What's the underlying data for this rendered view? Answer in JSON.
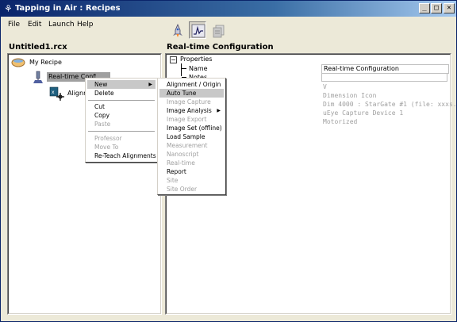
{
  "window": {
    "title": "Tapping in Air : Recipes"
  },
  "titlebar_buttons": {
    "minimize": "_",
    "maximize": "□",
    "close": "✕"
  },
  "menubar": [
    "File",
    "Edit",
    "Launch",
    "Help"
  ],
  "left": {
    "title": "Untitled1.rcx",
    "tree": {
      "root": "My Recipe",
      "child": "Real-time Configuration",
      "grandchild": "Alignment"
    }
  },
  "right": {
    "title": "Real-time Configuration",
    "properties_label": "Properties",
    "property_names": [
      "Name",
      "Notes"
    ],
    "header_field": "Real-time Configuration",
    "values": [
      "V",
      "Dimension Icon",
      "Dim 4000 : StarGate #1 (file: xxxs...",
      "uEye Capture Device 1",
      "Motorized"
    ]
  },
  "context_menu": {
    "items": [
      {
        "label": "New",
        "submenu": true,
        "highlighted": true
      },
      {
        "label": "Delete"
      },
      {
        "sep": true
      },
      {
        "label": "Cut"
      },
      {
        "label": "Copy"
      },
      {
        "label": "Paste",
        "disabled": true
      },
      {
        "sep": true
      },
      {
        "label": "Professor",
        "disabled": true
      },
      {
        "label": "Move To",
        "disabled": true
      },
      {
        "label": "Re-Teach Alignments"
      }
    ]
  },
  "submenu": {
    "items": [
      {
        "label": "Alignment / Origin"
      },
      {
        "label": "Auto Tune",
        "highlighted": true
      },
      {
        "label": "Image Capture",
        "disabled": true
      },
      {
        "label": "Image Analysis",
        "submenu": true
      },
      {
        "label": "Image Export",
        "disabled": true
      },
      {
        "label": "Image Set (offline)"
      },
      {
        "label": "Load Sample"
      },
      {
        "label": "Measurement",
        "disabled": true
      },
      {
        "label": "Nanoscript",
        "disabled": true
      },
      {
        "label": "Real-time",
        "disabled": true
      },
      {
        "label": "Report"
      },
      {
        "label": "Site",
        "disabled": true
      },
      {
        "label": "Site Order",
        "disabled": true
      }
    ]
  },
  "colors": {
    "titlebar": "#0a246a",
    "menu_highlight": "#c8c8c8",
    "disabled_text": "#a0a0a0"
  }
}
